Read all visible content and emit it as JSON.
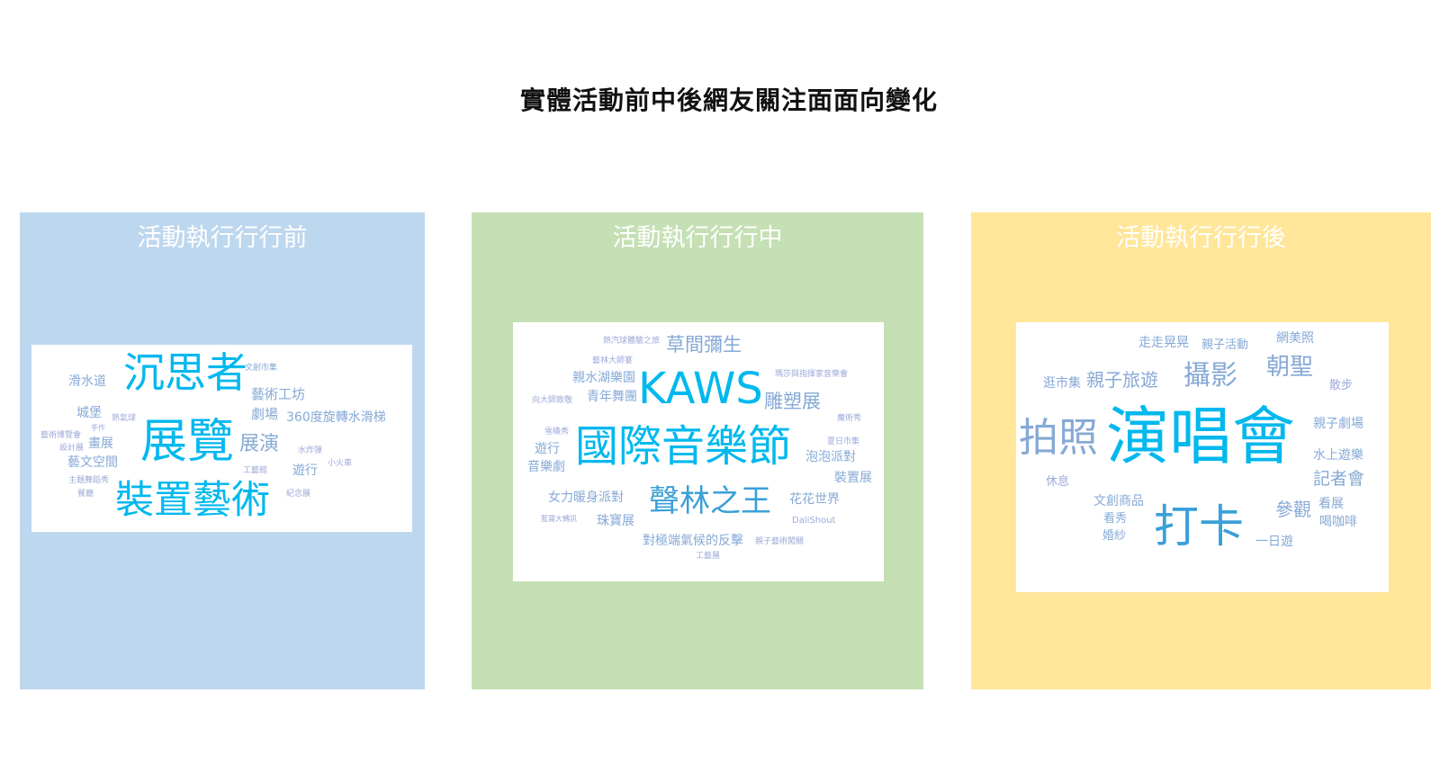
{
  "title": "實體活動前中後網友關注面面向變化",
  "panels": {
    "before": {
      "title": "活動執行行行前",
      "color": "#bdd7ee",
      "words": [
        "滑水道",
        "沉思者",
        "文創市集",
        "藝術工坊",
        "城堡",
        "熱氣球",
        "劇場",
        "360度旋轉水滑梯",
        "手作",
        "藝術博覽會",
        "展覽",
        "展演",
        "設計展",
        "畫展",
        "水炸彈",
        "小火車",
        "藝文空間",
        "工藝館",
        "遊行",
        "主題舞蹈秀",
        "餐廳",
        "裝置藝術",
        "紀念展"
      ]
    },
    "during": {
      "title": "活動執行行行中",
      "color": "#c5e0b4",
      "words": [
        "熱汽球體驗之旅",
        "草間彌生",
        "藝林大師宴",
        "親水湖樂園",
        "KAWS",
        "瑪莎與指揮家音樂會",
        "青年舞團",
        "向大師致敬",
        "雕塑展",
        "魔術秀",
        "雪橇秀",
        "國際音樂節",
        "夏日市集",
        "遊行",
        "泡泡派對",
        "音樂劇",
        "裝置展",
        "女力暖身派對",
        "聲林之王",
        "花花世界",
        "藍寶大轉訊",
        "珠寶展",
        "DaliShout",
        "對極端氣候的反擊",
        "親子藝術闖關",
        "工藝展"
      ]
    },
    "after": {
      "title": "活動執行行行後",
      "color": "#ffe699",
      "words": [
        "走走晃晃",
        "親子活動",
        "網美照",
        "逛市集",
        "親子旅遊",
        "攝影",
        "朝聖",
        "散步",
        "拍照",
        "演唱會",
        "親子劇場",
        "休息",
        "水上遊樂",
        "記者會",
        "文創商品",
        "參觀",
        "看展",
        "看秀",
        "打卡",
        "喝咖啡",
        "婚紗",
        "一日遊"
      ]
    }
  }
}
